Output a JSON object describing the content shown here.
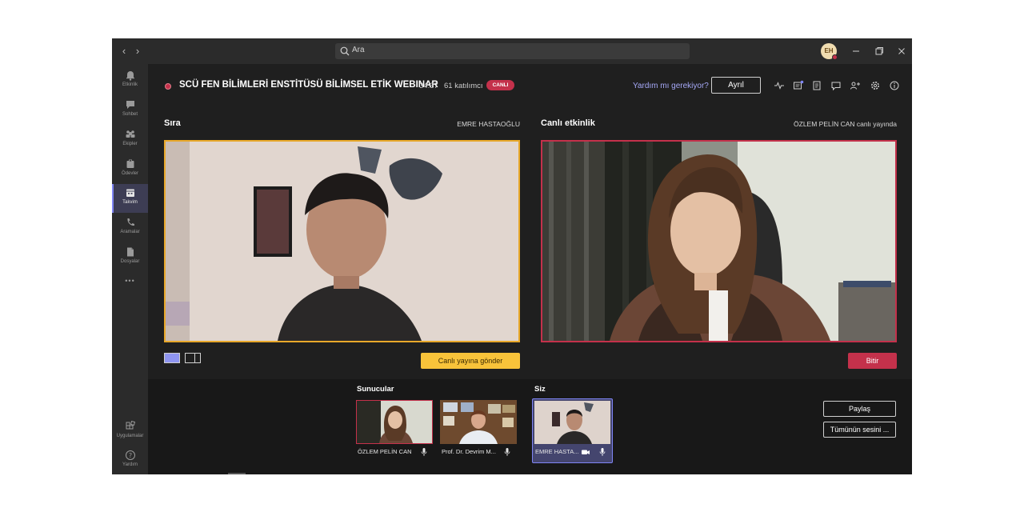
{
  "search": {
    "placeholder": "Ara"
  },
  "user": {
    "initials": "EH"
  },
  "rail": {
    "items": [
      {
        "label": "Etkinlik",
        "icon": "bell-icon"
      },
      {
        "label": "Sohbet",
        "icon": "chat-icon"
      },
      {
        "label": "Ekipler",
        "icon": "teams-icon"
      },
      {
        "label": "Ödevler",
        "icon": "assignments-icon"
      },
      {
        "label": "Takvim",
        "icon": "calendar-icon",
        "active": true
      },
      {
        "label": "Aramalar",
        "icon": "phone-icon"
      },
      {
        "label": "Dosyalar",
        "icon": "files-icon"
      }
    ],
    "more": "•••",
    "apps_label": "Uygulamalar",
    "help_label": "Yardım"
  },
  "meeting": {
    "title": "SCÜ FEN BİLİMLERİ ENSTİTÜSÜ BİLİMSEL ETİK WEBINAR",
    "time": "34:37",
    "participants": "61 katılımcı",
    "live_badge": "CANLI",
    "help_link": "Yardım mı gerekiyor?",
    "leave_label": "Ayrıl"
  },
  "queue": {
    "heading": "Sıra",
    "presenter": "EMRE HASTAOĞLU",
    "send_live_label": "Canlı yayına gönder"
  },
  "live": {
    "heading": "Canlı etkinlik",
    "status": "ÖZLEM PELİN CAN canlı yayında",
    "end_label": "Bitir"
  },
  "strip": {
    "presenters_heading": "Sunucular",
    "you_heading": "Siz",
    "presenters": [
      {
        "name": "ÖZLEM PELİN CAN"
      },
      {
        "name": "Prof. Dr. Devrim M..."
      }
    ],
    "me": {
      "name": "EMRE HASTA..."
    },
    "share_label": "Paylaş",
    "mute_all_label": "Tümünün sesini ..."
  },
  "colors": {
    "accent": "#7f85f5",
    "live_red": "#c4314b",
    "queue_yellow": "#f8c33a"
  }
}
